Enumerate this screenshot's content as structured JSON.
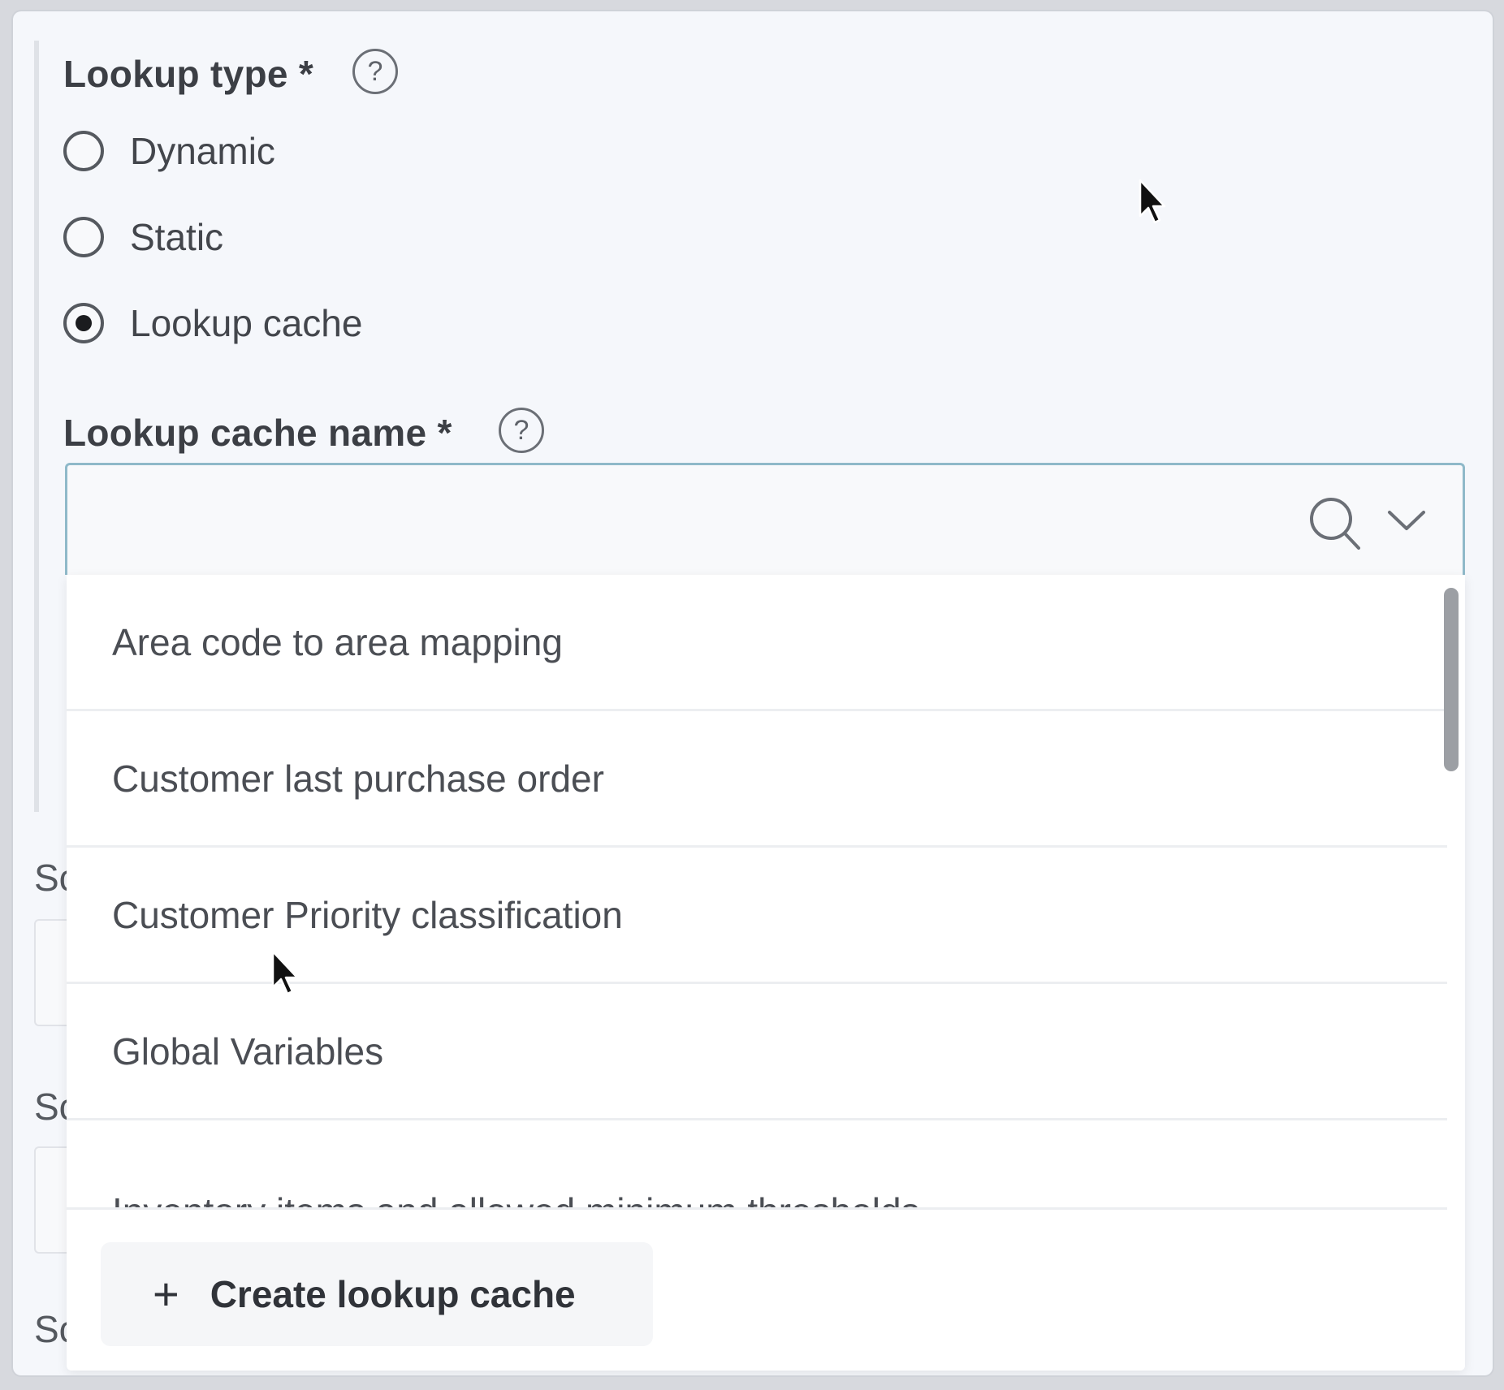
{
  "lookup_type": {
    "label": "Lookup type",
    "required_mark": "*",
    "help_icon": "question-circle-icon",
    "options": [
      {
        "label": "Dynamic",
        "checked": false
      },
      {
        "label": "Static",
        "checked": false
      },
      {
        "label": "Lookup cache",
        "checked": true
      }
    ]
  },
  "lookup_cache_name": {
    "label": "Lookup cache name",
    "required_mark": "*",
    "help_icon": "question-circle-icon",
    "value": "",
    "search_icon": "search-icon",
    "toggle_icon": "chevron-down-icon",
    "help_glyph": "?"
  },
  "dropdown": {
    "items": [
      "Area code to area mapping",
      "Customer last purchase order",
      "Customer Priority classification",
      "Global Variables",
      "Inventory items and allowed minimum thresholds"
    ],
    "create_button": {
      "icon": "plus-icon",
      "glyph": "+",
      "label": "Create lookup cache"
    }
  },
  "background_fields": {
    "partial_label": "Sc"
  },
  "colors": {
    "focus_border": "#8fb9c9",
    "selected_radio": "#1b1c1f",
    "panel_bg": "#f5f7fb"
  }
}
